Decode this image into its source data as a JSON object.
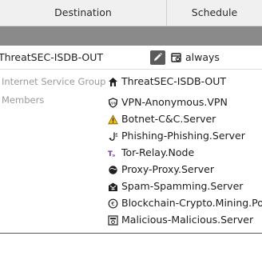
{
  "header": {
    "destination": "Destination",
    "schedule": "Schedule"
  },
  "policy_row": {
    "name": "ThreatSEC-ISDB-OUT",
    "schedule": "always"
  },
  "details": {
    "label_1": "Internet Service Group",
    "label_2": "Members",
    "group_name": "ThreatSEC-ISDB-OUT",
    "members": [
      {
        "label": "VPN-Anonymous.VPN",
        "icon": "vpn-shield-icon"
      },
      {
        "label": "Botnet-C&C.Server",
        "icon": "warning-icon"
      },
      {
        "label": "Phishing-Phishing.Server",
        "icon": "phishing-hook-icon"
      },
      {
        "label": "Tor-Relay.Node",
        "icon": "tor-icon"
      },
      {
        "label": "Proxy-Proxy.Server",
        "icon": "proxy-globe-icon"
      },
      {
        "label": "Spam-Spamming.Server",
        "icon": "spam-mail-icon"
      },
      {
        "label": "Blockchain-Crypto.Mining.Pool",
        "icon": "crypto-coin-icon"
      },
      {
        "label": "Malicious-Malicious.Server",
        "icon": "malicious-server-icon"
      }
    ]
  }
}
